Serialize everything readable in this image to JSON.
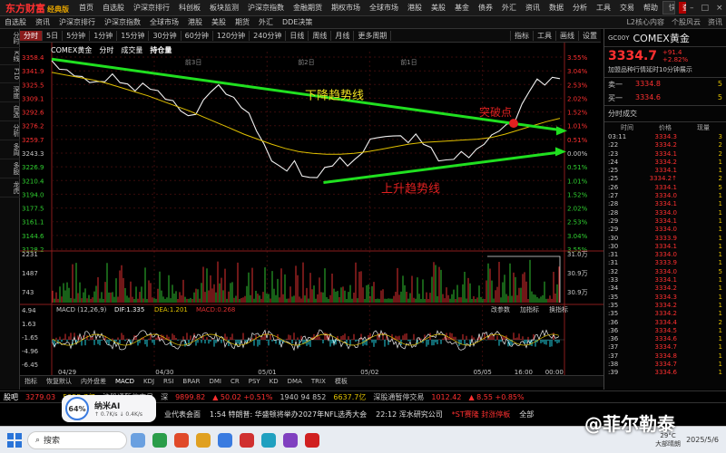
{
  "app": {
    "logo": "东方财富",
    "logo_sub": "经典版",
    "menu": [
      "首页",
      "自选股",
      "沪深京排行",
      "科创板",
      "板块监测",
      "沪深京指数",
      "金融期货",
      "期权市场",
      "全球市场",
      "港股",
      "美股",
      "基金",
      "债券",
      "外汇",
      "资讯",
      "数据",
      "分析",
      "工具",
      "交易",
      "帮助"
    ],
    "search_placeholder": "快速交易F12",
    "news_banner": "查看巍华新材等31条新消息"
  },
  "subbar": {
    "items": [
      "自选股",
      "资讯",
      "沪深京排行",
      "沪深京指数",
      "全球市场",
      "港股",
      "美股",
      "期货",
      "外汇",
      "DDE决策"
    ],
    "right": [
      "L2核心内容",
      "个股风云",
      "资讯"
    ]
  },
  "sidebar": [
    "分时",
    "K线",
    "F10",
    "深度",
    "自选",
    "分析",
    "多周",
    "多股",
    "龙虎"
  ],
  "period_tabs": {
    "items": [
      "分时",
      "5日",
      "5分钟",
      "1分钟",
      "15分钟",
      "30分钟",
      "60分钟",
      "120分钟",
      "240分钟",
      "日线",
      "周线",
      "月线",
      "更多周期"
    ],
    "active_index": 0,
    "right": [
      "指标",
      "工具",
      "画线",
      "设置"
    ]
  },
  "chart_legend": {
    "name": "COMEX黄金",
    "items": [
      "分时",
      "成交量",
      "持仓量"
    ]
  },
  "chart_data": {
    "type": "line",
    "price_ticks": [
      3358.4,
      3341.9,
      3325.5,
      3309.1,
      3292.6,
      3276.2,
      3259.7,
      3243.3,
      3226.9,
      3210.4,
      3194.0,
      3177.5,
      3161.1,
      3144.6,
      3128.2
    ],
    "pct_ticks": [
      "3.55%",
      "3.04%",
      "2.53%",
      "2.02%",
      "1.52%",
      "1.01%",
      "0.51%",
      "0.00%",
      "0.51%",
      "1.01%",
      "1.52%",
      "2.02%",
      "2.53%",
      "3.04%",
      "3.55%"
    ],
    "ylim": [
      3128.2,
      3358.4
    ],
    "day_markers": [
      "前3日",
      "前2日",
      "前1日"
    ],
    "x_labels": [
      "04/29",
      "04/30",
      "05/01",
      "05/02",
      "05/05",
      "16:00",
      "00:00"
    ],
    "price_series": [
      3352,
      3346,
      3341,
      3338,
      3333,
      3330,
      3327,
      3331,
      3336,
      3330,
      3324,
      3320,
      3325,
      3322,
      3316,
      3310,
      3304,
      3296,
      3286,
      3292,
      3305,
      3319,
      3323,
      3316,
      3308,
      3300,
      3289,
      3272,
      3252,
      3236,
      3226,
      3224,
      3232,
      3218,
      3212,
      3216,
      3224,
      3230,
      3236,
      3230,
      3234,
      3246,
      3258,
      3264,
      3261,
      3266,
      3262,
      3258,
      3264,
      3256,
      3248,
      3236,
      3233,
      3238,
      3243,
      3240,
      3246,
      3256,
      3263,
      3272,
      3276,
      3282,
      3300,
      3320,
      3330,
      3327,
      3332,
      3334.7
    ],
    "avg_series": [
      3340,
      3337,
      3334,
      3331,
      3327,
      3322,
      3317,
      3312,
      3306,
      3300,
      3294,
      3287,
      3280,
      3273,
      3266,
      3260,
      3254,
      3249,
      3245,
      3243,
      3242,
      3242,
      3243,
      3245,
      3248,
      3251,
      3254,
      3256,
      3257,
      3258,
      3259,
      3260,
      3262,
      3266,
      3271,
      3276,
      3281,
      3285
    ],
    "volume_ticks": [
      "2231",
      "1487",
      "743"
    ],
    "volume_right_ticks": [
      "31.0万",
      "30.9万",
      "30.9万"
    ],
    "macd_label": "MACD (12,26,9)",
    "macd_dif": "DIF:1.335",
    "macd_dea": "DEA:1.201",
    "macd_val": "MACD:0.268",
    "macd_ticks": [
      "4.94",
      "1.63",
      "-1.65",
      "-4.96",
      "-6.45"
    ],
    "macd_right": [
      "改参数",
      "加指标",
      "换指标"
    ],
    "annotations": {
      "down_trend": "下降趋势线",
      "up_trend": "上升趋势线",
      "breakout": "突破点"
    }
  },
  "quote": {
    "code": "GC00Y",
    "name": "COMEX黄金",
    "price": "3334.7",
    "change": "+91.4",
    "change_pct": "+2.82%",
    "note": "加盟品种行情延时10分钟展示",
    "sell_label": "卖一",
    "sell_price": "3334.8",
    "sell_qty": "5",
    "buy_label": "买一",
    "buy_price": "3334.6",
    "buy_qty": "5",
    "ticks_title": "分时成交",
    "ticks_cols": [
      "时间",
      "价格",
      "现量"
    ],
    "ticks": [
      {
        "t": "03:11",
        "p": "3334.3",
        "q": "3"
      },
      {
        "t": ":22",
        "p": "3334.2",
        "q": "2"
      },
      {
        "t": ":23",
        "p": "3334.1",
        "q": "2"
      },
      {
        "t": ":24",
        "p": "3334.2",
        "q": "1"
      },
      {
        "t": ":25",
        "p": "3334.1",
        "q": "1"
      },
      {
        "t": ":25",
        "p": "3334.2↑",
        "q": "2"
      },
      {
        "t": ":26",
        "p": "3334.1",
        "q": "5"
      },
      {
        "t": ":27",
        "p": "3334.0",
        "q": "1"
      },
      {
        "t": ":28",
        "p": "3334.1",
        "q": "1"
      },
      {
        "t": ":28",
        "p": "3334.0",
        "q": "1"
      },
      {
        "t": ":29",
        "p": "3334.1",
        "q": "1"
      },
      {
        "t": ":29",
        "p": "3334.0",
        "q": "1"
      },
      {
        "t": ":30",
        "p": "3333.9",
        "q": "1"
      },
      {
        "t": ":30",
        "p": "3334.1",
        "q": "1"
      },
      {
        "t": ":31",
        "p": "3334.0",
        "q": "1"
      },
      {
        "t": ":31",
        "p": "3333.9",
        "q": "1"
      },
      {
        "t": ":32",
        "p": "3334.0",
        "q": "5"
      },
      {
        "t": ":33",
        "p": "3334.1",
        "q": "1"
      },
      {
        "t": ":34",
        "p": "3334.2",
        "q": "1"
      },
      {
        "t": ":35",
        "p": "3334.3",
        "q": "1"
      },
      {
        "t": ":35",
        "p": "3334.2",
        "q": "1"
      },
      {
        "t": ":35",
        "p": "3334.2",
        "q": "1"
      },
      {
        "t": ":36",
        "p": "3334.4",
        "q": "2"
      },
      {
        "t": ":36",
        "p": "3334.5",
        "q": "1"
      },
      {
        "t": ":36",
        "p": "3334.6",
        "q": "1"
      },
      {
        "t": ":37",
        "p": "3334.7",
        "q": "1"
      },
      {
        "t": ":37",
        "p": "3334.8",
        "q": "1"
      },
      {
        "t": ":38",
        "p": "3334.7",
        "q": "1"
      },
      {
        "t": ":39",
        "p": "3334.6",
        "q": "1"
      }
    ]
  },
  "bottom_tabs": [
    "指标",
    "恢复默认",
    "内外盘差",
    "MACD",
    "KDJ",
    "RSI",
    "BRAR",
    "DMI",
    "CR",
    "PSY",
    "KD",
    "DMA",
    "TRIX",
    "模板"
  ],
  "index_bar": [
    {
      "text": "股吧",
      "color": "#ffffff"
    },
    {
      "text": "3279.03",
      "color": "#ff3030"
    },
    {
      "text": "5055.7亿",
      "color": "#e0c000"
    },
    {
      "text": "沪股通暂停交易",
      "color": "#c8c8c8"
    },
    {
      "text": "深",
      "color": "#c8c8c8"
    },
    {
      "text": "9899.82",
      "color": "#ff3030"
    },
    {
      "text": "▲ 50.02 +0.51%",
      "color": "#ff3030"
    },
    {
      "text": "1940 94 852",
      "color": "#c8c8c8"
    },
    {
      "text": "6637.7亿",
      "color": "#e0c000"
    },
    {
      "text": "深股通暂停交易",
      "color": "#c8c8c8"
    },
    {
      "text": "1012.42",
      "color": "#ff3030"
    },
    {
      "text": "▲ 8.55 +0.85%",
      "color": "#ff3030"
    }
  ],
  "news_bar": [
    "业代表会面",
    "1:54 特朗普: 华盛顿将举办2027年NFL选秀大会",
    "22:12 浑水研究公司",
    "*ST赛隆 封涨停板",
    "全部"
  ],
  "ai_widget": {
    "pct": "64%",
    "title": "纳米AI",
    "stats": "↑ 0.7K/s  ↓ 0.4K/s"
  },
  "taskbar": {
    "search": "搜索",
    "weather_temp": "29°C",
    "weather_text": "大部晴朗",
    "date": "2025/5/6"
  },
  "watermark": "@菲尔勒泰"
}
